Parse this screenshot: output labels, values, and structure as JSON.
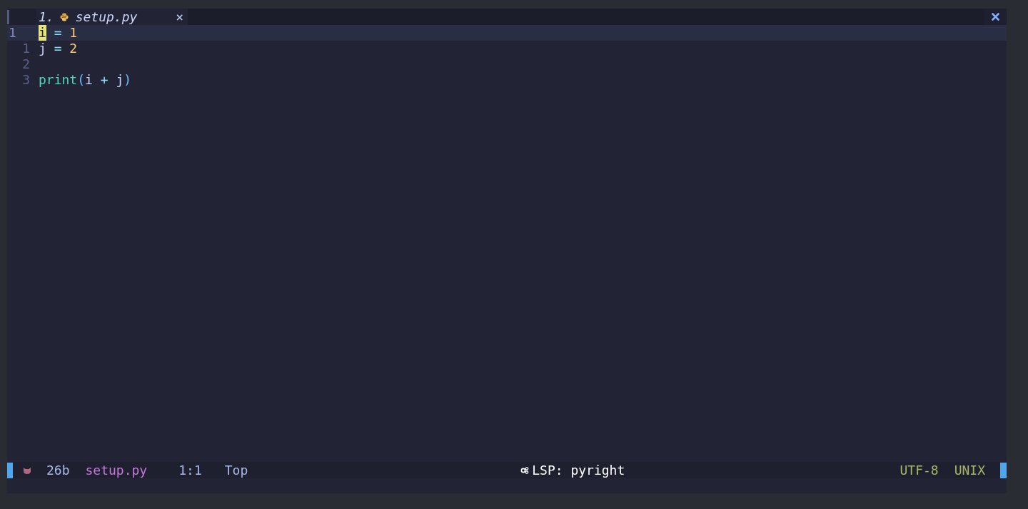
{
  "tab": {
    "index": "1.",
    "name": "setup.py",
    "close": "×",
    "selected": true
  },
  "lines": [
    {
      "number": "1",
      "current": true,
      "tokens": [
        {
          "text": "i",
          "kind": "var",
          "cursor": true
        },
        {
          "text": " = ",
          "kind": "op",
          "cursor": false
        },
        {
          "text": "1",
          "kind": "num",
          "cursor": false
        }
      ]
    },
    {
      "number": "1",
      "current": false,
      "tokens": [
        {
          "text": "j",
          "kind": "var",
          "cursor": false
        },
        {
          "text": " = ",
          "kind": "op",
          "cursor": false
        },
        {
          "text": "2",
          "kind": "num",
          "cursor": false
        }
      ]
    },
    {
      "number": "2",
      "current": false
    },
    {
      "number": "3",
      "current": false,
      "tokens": [
        {
          "text": "print",
          "kind": "func",
          "cursor": false
        },
        {
          "text": "(",
          "kind": "paren",
          "cursor": false
        },
        {
          "text": "i",
          "kind": "var",
          "cursor": false
        },
        {
          "text": " + ",
          "kind": "op",
          "cursor": false
        },
        {
          "text": "j",
          "kind": "var",
          "cursor": false
        },
        {
          "text": ")",
          "kind": "paren",
          "cursor": false
        }
      ]
    }
  ],
  "status_bar": {
    "size": "26b",
    "file": "setup.py",
    "position": "1:1",
    "scroll": "Top",
    "lsp": "LSP: pyright",
    "encoding": "UTF-8",
    "eol": "UNIX"
  }
}
